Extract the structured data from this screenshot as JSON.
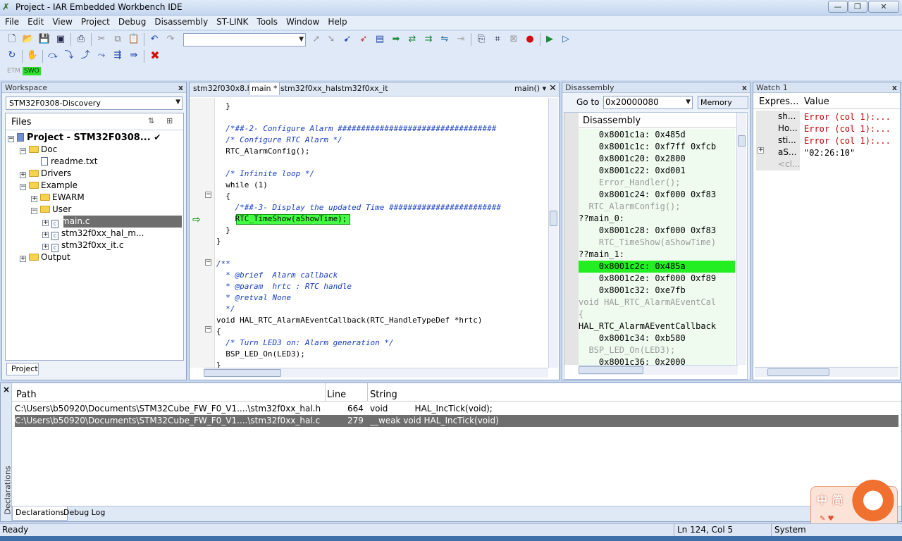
{
  "window": {
    "title": "Project - IAR Embedded Workbench IDE",
    "min": "—",
    "max": "❐",
    "close": "✕"
  },
  "menu": [
    "File",
    "Edit",
    "View",
    "Project",
    "Debug",
    "Disassembly",
    "ST-LINK",
    "Tools",
    "Window",
    "Help"
  ],
  "toolbar3": {
    "etm": "ETM",
    "swo": "SWO"
  },
  "workspace": {
    "header": "Workspace",
    "selector": "STM32F0308-Discovery",
    "files_header": "Files",
    "tree": [
      {
        "label": "Project - STM32F0308...",
        "kind": "project",
        "check": "✔"
      },
      {
        "label": "Doc",
        "kind": "folder"
      },
      {
        "label": "readme.txt",
        "kind": "file"
      },
      {
        "label": "Drivers",
        "kind": "folder"
      },
      {
        "label": "Example",
        "kind": "folder"
      },
      {
        "label": "EWARM",
        "kind": "folder"
      },
      {
        "label": "User",
        "kind": "folder"
      },
      {
        "label": "main.c",
        "kind": "file"
      },
      {
        "label": "stm32f0xx_hal_m...",
        "kind": "file"
      },
      {
        "label": "stm32f0xx_it.c",
        "kind": "file"
      },
      {
        "label": "Output",
        "kind": "folder"
      }
    ],
    "bottom_tab": "Project"
  },
  "editor": {
    "tabs": [
      "stm32f030x8.h",
      "main *",
      "stm32f0xx_hal",
      "stm32f0xx_it"
    ],
    "func_selector": "main()",
    "lines": [
      "  }",
      "",
      "  /*##-2- Configure Alarm ##################################",
      "  /* Configure RTC Alarm */",
      "  RTC_AlarmConfig();",
      "",
      "  /* Infinite loop */",
      "  while (1)",
      "  {",
      "    /*##-3- Display the updated Time ########################",
      "    RTC_TimeShow(aShowTime);",
      "  }",
      "}",
      "",
      "/**",
      "  * @brief  Alarm callback",
      "  * @param  hrtc : RTC handle",
      "  * @retval None",
      "  */",
      "void HAL_RTC_AlarmAEventCallback(RTC_HandleTypeDef *hrtc)",
      "{",
      "  /* Turn LED3 on: Alarm generation */",
      "  BSP_LED_On(LED3);",
      "}"
    ]
  },
  "disassembly": {
    "header": "Disassembly",
    "goto_label": "Go to",
    "goto_value": "0x20000080",
    "memory_button": "Memory",
    "col_header": "Disassembly",
    "lines": [
      "    0x8001c1a: 0x485d",
      "    0x8001c1c: 0xf7ff 0xfcb",
      "    0x8001c20: 0x2800",
      "    0x8001c22: 0xd001",
      "    Error_Handler();",
      "    0x8001c24: 0xf000 0xf83",
      "  RTC_AlarmConfig();",
      "??main_0:",
      "    0x8001c28: 0xf000 0xf83",
      "    RTC_TimeShow(aShowTime)",
      "??main_1:",
      "    0x8001c2c: 0x485a",
      "    0x8001c2e: 0xf000 0xf89",
      "    0x8001c32: 0xe7fb",
      "void HAL_RTC_AlarmAEventCal",
      "{",
      "HAL_RTC_AlarmAEventCallback",
      "    0x8001c34: 0xb580",
      "  BSP_LED_On(LED3);",
      "    0x8001c36: 0x2000"
    ]
  },
  "watch": {
    "header": "Watch 1",
    "col_expr": "Expres...",
    "col_value": "Value",
    "rows": [
      {
        "expr": "sh...",
        "value": "Error (col 1):..."
      },
      {
        "expr": "Ho...",
        "value": "Error (col 1):..."
      },
      {
        "expr": "sti...",
        "value": "Error (col 1):..."
      },
      {
        "expr": "aS...",
        "value": "\"02:26:10\""
      },
      {
        "expr": "<cl...",
        "value": ""
      }
    ]
  },
  "results": {
    "side_label": "Declarations",
    "cols": [
      "Path",
      "Line",
      "String"
    ],
    "rows": [
      {
        "path": "C:\\Users\\b50920\\Documents\\STM32Cube_FW_F0_V1....\\stm32f0xx_hal.h",
        "line": "664",
        "string": "void          HAL_IncTick(void);"
      },
      {
        "path": "C:\\Users\\b50920\\Documents\\STM32Cube_FW_F0_V1....\\stm32f0xx_hal.c",
        "line": "279",
        "string": "__weak void HAL_IncTick(void)"
      }
    ],
    "tabs": [
      "Declarations",
      "Debug Log"
    ]
  },
  "status": {
    "left": "Ready",
    "pos": "Ln 124, Col 5",
    "mode": "System"
  },
  "ime": {
    "zh": "中",
    "jian": "简"
  },
  "colors": {
    "highlight": "#44ff44",
    "selection": "#6e6e6e",
    "comment": "#1a40c0",
    "error": "#c00000"
  }
}
